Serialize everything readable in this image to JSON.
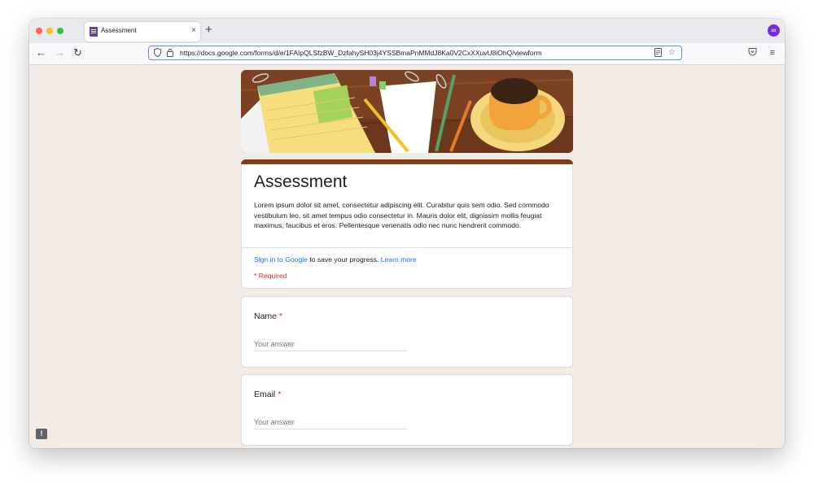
{
  "browser": {
    "tab": {
      "title": "Assessment",
      "close": "×"
    },
    "new_tab": "+",
    "url": "https://docs.google.com/forms/d/e/1FAIpQLSfzBW_DzfahySH03j4YSSBmaPnMMdJ8Ka0V2CxXXuvU8iOhQ/viewform",
    "nav": {
      "back": "←",
      "forward": "→",
      "reload": "↻"
    },
    "icons": {
      "shield": "shield-icon",
      "lock": "lock-icon",
      "reader": "reader-view-icon",
      "star": "bookmark-star-icon",
      "pocket": "pocket-icon",
      "menu": "hamburger-menu-icon",
      "account": "account-icon"
    },
    "colors": {
      "accent": "#5a8ee8",
      "account": "#7a2bd7"
    }
  },
  "form": {
    "title": "Assessment",
    "description": "Lorem ipsum dolor sit amet, consectetur adipiscing elit. Curabitur quis sem odio. Sed commodo vestibulum leo, sit amet tempus odio consectetur in. Mauris dolor elit, dignissim mollis feugiat maximus, faucibus et eros. Pellentesque venenatis odio nec nunc hendrerit commodo.",
    "signin_link": "Sign in to Google",
    "signin_rest": " to save your progress. ",
    "learn_more": "Learn more",
    "required_note": "* Required",
    "theme_color": "#863c1c",
    "questions": [
      {
        "label": "Name",
        "required_mark": "*",
        "placeholder": "Your answer"
      },
      {
        "label": "Email",
        "required_mark": "*",
        "placeholder": "Your answer"
      }
    ]
  },
  "feedback": {
    "label": "!"
  }
}
